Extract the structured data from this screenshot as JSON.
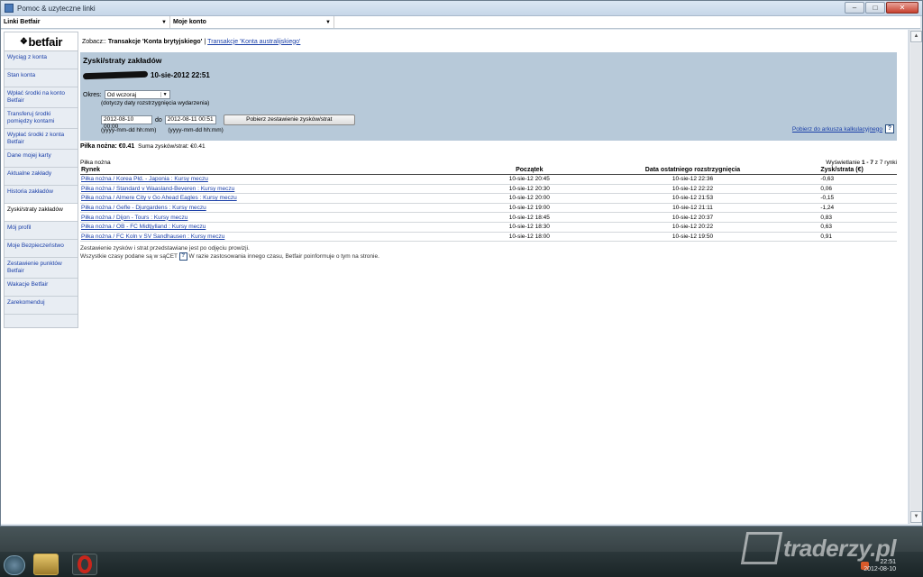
{
  "window": {
    "title": "Pomoc & uzyteczne linki"
  },
  "topbar": {
    "links_select": "Linki Betfair",
    "account_select": "Moje konto"
  },
  "sidebar": {
    "logo_text": "betfair",
    "items": [
      {
        "label": "Wyciąg z konta"
      },
      {
        "label": "Stan konta"
      },
      {
        "label": "Wpłać środki na konto Betfair"
      },
      {
        "label": "Transferuj środki pomiędzy kontami"
      },
      {
        "label": "Wypłać środki z konta Betfair"
      },
      {
        "label": "Dane mojej karty"
      },
      {
        "label": "Aktualne zakłady"
      },
      {
        "label": "Historia zakładów"
      },
      {
        "label": "Zyski/straty zakładów"
      },
      {
        "label": "Mój profil"
      },
      {
        "label": "Moje Bezpieczeństwo"
      },
      {
        "label": "Zestawienie punktów Betfair"
      },
      {
        "label": "Wakacje Betfair"
      },
      {
        "label": "Zarekomenduj"
      }
    ]
  },
  "breadcrumb": {
    "prefix": "Zobacz::",
    "current": "Transakcje 'Konta brytyjskiego'",
    "separator": "|",
    "other_link": "Transakcje 'Konta australijskiego'"
  },
  "panel": {
    "heading": "Zyski/straty zakładów",
    "datetime": "10-sie-2012 22:51",
    "period_label": "Okres:",
    "period_value": "Od wczoraj",
    "period_note": "(dotyczy daty rozstrzygnięcia wydarzenia)",
    "date_from": "2012-08-10 00:00",
    "to_label": "do",
    "date_to": "2012-08-11 00:51",
    "submit_label": "Pobierz zestawienie zysków/strat",
    "format_hint_from": "(yyyy-mm-dd hh:mm)",
    "format_hint_to": "(yyyy-mm-dd hh:mm)",
    "download_link": "Pobierz do arkusza kalkulacyjnego",
    "help": "?"
  },
  "summary": {
    "sport_label": "Piłka nożna: €0.41",
    "total_label": "Suma zysków/strat:",
    "total_value": "€0.41"
  },
  "table": {
    "caption": "Piłka nożna",
    "showing_prefix": "Wyświetlanie",
    "showing_range": "1 - 7",
    "showing_suffix": "z 7 rynki",
    "headers": {
      "market": "Rynek",
      "start": "Początek",
      "settled": "Data ostatniego rozstrzygnięcia",
      "pl": "Zysk/strata (€)"
    },
    "rows": [
      {
        "market": "Piłka nożna / Korea Płd. - Japonia : Kursy meczu",
        "start": "10-sie-12 20:45",
        "settled": "10-sie-12 22:36",
        "pl": "-0,63"
      },
      {
        "market": "Piłka nożna / Standard v Waasland-Beveren : Kursy meczu",
        "start": "10-sie-12 20:30",
        "settled": "10-sie-12 22:22",
        "pl": "0,06"
      },
      {
        "market": "Piłka nożna / Almere City v Go Ahead Eagles : Kursy meczu",
        "start": "10-sie-12 20:00",
        "settled": "10-sie-12 21:53",
        "pl": "-0,15"
      },
      {
        "market": "Piłka nożna / Gefle - Djurgardens : Kursy meczu",
        "start": "10-sie-12 19:00",
        "settled": "10-sie-12 21:11",
        "pl": "-1,24"
      },
      {
        "market": "Piłka nożna / Dijon - Tours : Kursy meczu",
        "start": "10-sie-12 18:45",
        "settled": "10-sie-12 20:37",
        "pl": "0,83"
      },
      {
        "market": "Piłka nożna / OB - FC Midtjylland : Kursy meczu",
        "start": "10-sie-12 18:30",
        "settled": "10-sie-12 20:22",
        "pl": "0,63"
      },
      {
        "market": "Piłka nożna / FC Koln v SV Sandhausen : Kursy meczu",
        "start": "10-sie-12 18:00",
        "settled": "10-sie-12 19:50",
        "pl": "0,91"
      }
    ]
  },
  "footnote": {
    "line1": "Zestawienie zysków i strat przedstawiane jest po odjęciu prowizji.",
    "line2_a": "Wszystkie czasy podane są w sąCET",
    "line2_b": "W razie zastosowania innego czasu, Betfair poinformuje o tym na stronie."
  },
  "taskbar": {
    "clock_time": "22:51",
    "clock_date": "2012-08-10",
    "watermark": "traderzy.pl"
  },
  "colors": {
    "panel_bg": "#b7c9d9",
    "link": "#1a3fa8",
    "close_button": "#c7412f"
  }
}
